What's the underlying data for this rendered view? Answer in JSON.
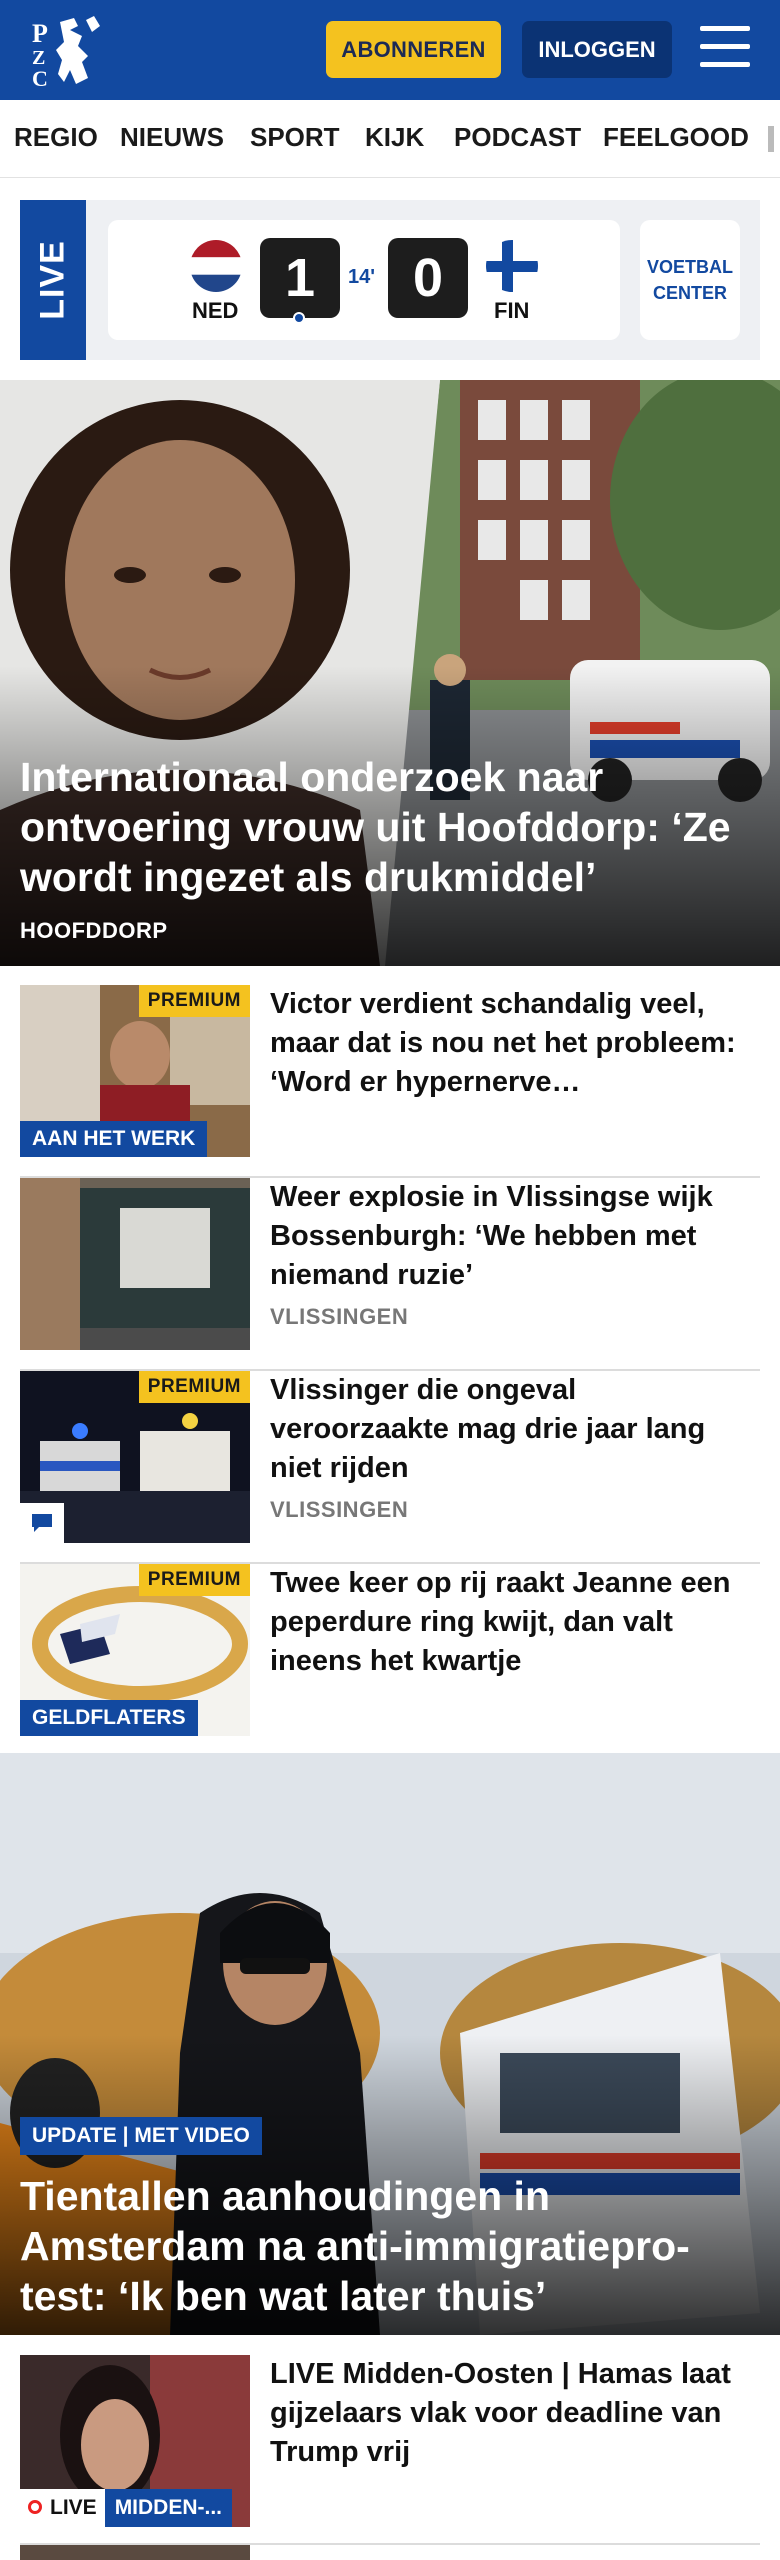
{
  "header": {
    "logo_text": "PZC",
    "subscribe_label": "ABONNEREN",
    "login_label": "INLOGGEN",
    "brand_color": "#1249a0",
    "accent_color": "#f4c21f"
  },
  "nav": {
    "items": [
      "REGIO",
      "NIEUWS",
      "SPORT",
      "KIJK",
      "PODCAST",
      "FEELGOOD"
    ]
  },
  "live": {
    "label": "LIVE",
    "home_team": "NED",
    "away_team": "FIN",
    "home_score": "1",
    "away_score": "0",
    "minute": "14'",
    "center_line1": "VOETBAL",
    "center_line2": "CENTER"
  },
  "hero": {
    "title": "Internationaal onderzoek naar ontvoering vrouw uit Hoofddorp: ‘Ze wordt ingezet als drukmiddel’",
    "location": "HOOFDDORP"
  },
  "articles": [
    {
      "title": "Victor verdient schandalig veel, maar dat is nou net het probleem: ‘Word er hypernerve…",
      "premium": "PREMIUM",
      "label": "AAN HET WERK"
    },
    {
      "title": "Weer explosie in Vlissingse wijk Bossenburgh: ‘We hebben met niemand ruzie’",
      "location": "VLISSINGEN"
    },
    {
      "title": "Vlissinger die ongeval veroorzaakte mag drie jaar lang niet rijden",
      "premium": "PREMIUM",
      "location": "VLISSINGEN"
    },
    {
      "title": "Twee keer op rij raakt Jeanne een peperdure ring kwijt, dan valt ineens het kwartje",
      "premium": "PREMIUM",
      "label": "GELDFLATERS"
    }
  ],
  "hero2": {
    "tag": "UPDATE | MET VIDEO",
    "title": "Tientallen aanhoudingen in Amsterdam na anti-immigratiepro-test: ‘Ik ben wat later thuis’"
  },
  "live_article": {
    "title": "LIVE Midden-Oosten | Hamas laat gijzelaars vlak voor deadline van Trump vrij",
    "live_label": "LIVE",
    "section_label": "MIDDEN-..."
  }
}
